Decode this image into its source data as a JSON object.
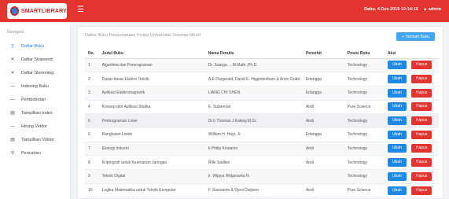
{
  "brand": {
    "name": "SMARTLIBRARY"
  },
  "header": {
    "datetime": "Rabu, 4 Des 2019 10:14:16",
    "user": "admin"
  },
  "sidebar": {
    "heading": "Navigasi",
    "items": [
      {
        "icon": "book-icon",
        "label": "Daftar Buku"
      },
      {
        "icon": "close-icon",
        "label": "Daftar Stopword"
      },
      {
        "icon": "close-icon",
        "label": "Daftar Stemming"
      },
      {
        "icon": "dash-icon",
        "label": "Indexing Buku"
      },
      {
        "icon": "dash-icon",
        "label": "Pembobotan"
      },
      {
        "icon": "table-icon",
        "label": "Tampilkan Index"
      },
      {
        "icon": "dash-icon",
        "label": "Hitung Vektor"
      },
      {
        "icon": "table-icon",
        "label": "Tampilkan Vektor"
      },
      {
        "icon": "search-icon",
        "label": "Pencarian"
      }
    ]
  },
  "main": {
    "title": "Daftar Buku Perpustakaan Fmipa Universitas Sebelas Maret",
    "add_button": "+ Tambah Buku",
    "columns": [
      "No.",
      "Judul Buku",
      "Nama Penulis",
      "Penerbit",
      "Posisi Buku",
      "Aksi"
    ],
    "edit_label": "Ubah",
    "delete_label": "Hapus",
    "rows": [
      {
        "no": "1",
        "judul": "Algoritma dan Pemrograman",
        "penulis": "Dr. Suarga, ., M.Math.,Ph.D.",
        "penerbit": "",
        "posisi": "Technology"
      },
      {
        "no": "2",
        "judul": "Dasar-dasar Elektro Teknik",
        "penulis": "A.E Fitzgerald, David E. Higginbotham & Arvin Grabl",
        "penerbit": "Erlangga",
        "posisi": "Technology"
      },
      {
        "no": "3",
        "judul": "Aplikasi Elektromagnetik",
        "penulis": "LIANG CHI SHEN",
        "penerbit": "Erlangga",
        "posisi": "Technology"
      },
      {
        "no": "4",
        "judul": "Konsep dan Aplikasi Statika",
        "penulis": "E. Sulaeman",
        "penerbit": "Andi",
        "posisi": "Pure Science"
      },
      {
        "no": "5",
        "judul": "Pemrograman Linier",
        "penulis": "Dr.Ir.Thomas J.Kakiay,M.Sc",
        "penerbit": "Andi",
        "posisi": "Technology"
      },
      {
        "no": "6",
        "judul": "Rangkaian Listrik",
        "penulis": "William H. Hayt, Jr",
        "penerbit": "Erlangga",
        "posisi": "Technology"
      },
      {
        "no": "7",
        "judul": "Ekologi Industri",
        "penulis": "Ir.Philip Kristanto",
        "penerbit": "Andi",
        "posisi": "Technology"
      },
      {
        "no": "8",
        "judul": "Kriptografi untuk Keamanan Jaringan",
        "penulis": "Rifki Sadikin",
        "penerbit": "Andi",
        "posisi": "Technology"
      },
      {
        "no": "9",
        "judul": "Teknik Digital",
        "penulis": "Ir. Wijaya Widjanarka N",
        "penerbit": "",
        "posisi": "Technology"
      },
      {
        "no": "10",
        "judul": "Logika Matematika untuk Teknik Komputer",
        "penulis": "F. Soesianto & Djoni Dwijono",
        "penerbit": "Andi",
        "posisi": "Pure Science"
      }
    ]
  },
  "colors": {
    "primary_red": "#e3342f",
    "primary_blue": "#1e88e5"
  }
}
